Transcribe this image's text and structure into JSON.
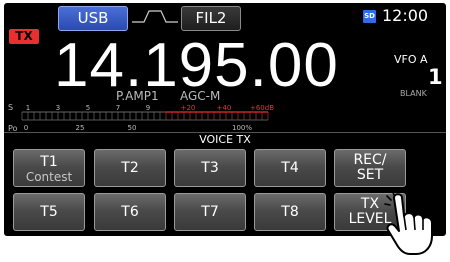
{
  "status": {
    "tx_badge": "TX",
    "mode": "USB",
    "filter": "FIL2",
    "sd_badge": "SD",
    "clock": "12:00"
  },
  "frequency": {
    "display": "14.195.00",
    "vfo_label": "VFO A",
    "vfo_number": "1",
    "blank_label": "BLANK",
    "pamp": "P.AMP1",
    "agc": "AGC-M"
  },
  "meter": {
    "s_label": "S",
    "s_ticks": [
      "1",
      "3",
      "5",
      "7",
      "9",
      "+20",
      "+40",
      "+60dB"
    ],
    "po_label": "Po",
    "po_ticks": [
      "0",
      "25",
      "50",
      "100%"
    ]
  },
  "voice_tx": {
    "title": "VOICE TX",
    "buttons": [
      {
        "label": "T1",
        "sub": "Contest"
      },
      {
        "label": "T2"
      },
      {
        "label": "T3"
      },
      {
        "label": "T4"
      },
      {
        "label_line1": "REC/",
        "label_line2": "SET"
      },
      {
        "label": "T5"
      },
      {
        "label": "T6"
      },
      {
        "label": "T7"
      },
      {
        "label": "T8"
      },
      {
        "label_line1": "TX",
        "label_line2": "LEVEL"
      }
    ]
  },
  "colors": {
    "tx_red": "#e83030",
    "mode_blue": "#3a5fd0",
    "meter_red": "#e83030",
    "sd_blue": "#2f6de0"
  }
}
